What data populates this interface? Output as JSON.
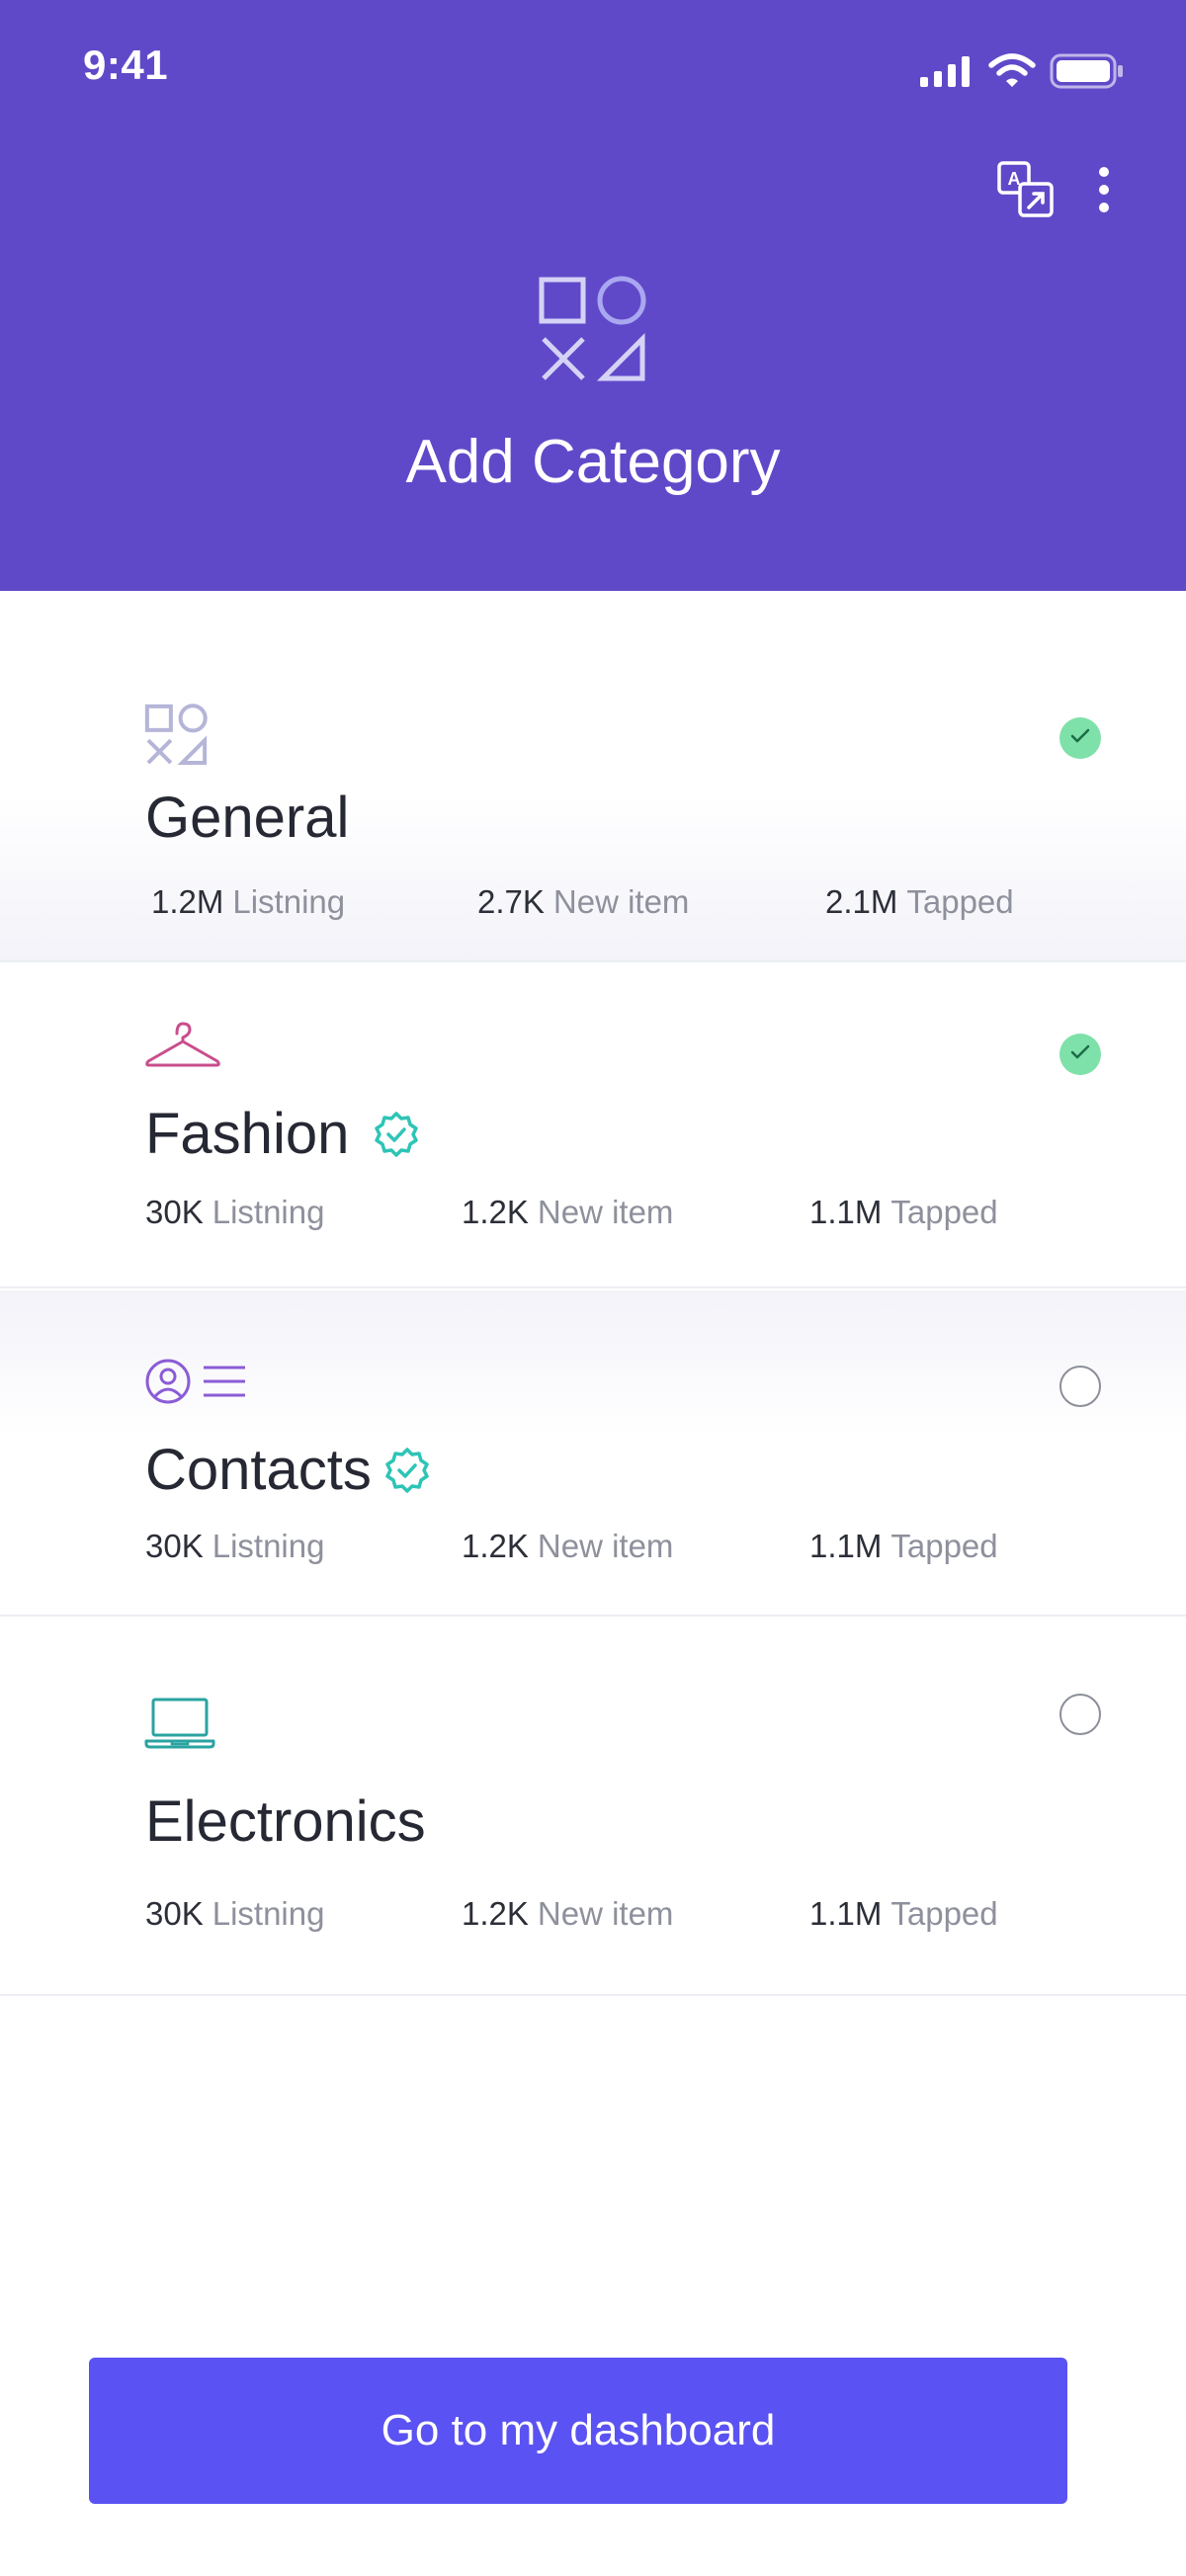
{
  "status_bar": {
    "time": "9:41"
  },
  "header": {
    "title": "Add Category",
    "hero_icon": "shapes-icon",
    "actions": [
      "translate-icon",
      "more-vertical-icon"
    ],
    "background": "#6049c9"
  },
  "categories": [
    {
      "name": "General",
      "icon": "shapes-icon",
      "verified": false,
      "selected": true,
      "stats": [
        {
          "value": "1.2M",
          "label": "Listning"
        },
        {
          "value": "2.7K",
          "label": "New item"
        },
        {
          "value": "2.1M",
          "label": "Tapped"
        }
      ]
    },
    {
      "name": "Fashion",
      "icon": "hanger-icon",
      "verified": true,
      "selected": true,
      "stats": [
        {
          "value": "30K",
          "label": "Listning"
        },
        {
          "value": "1.2K",
          "label": "New item"
        },
        {
          "value": "1.1M",
          "label": "Tapped"
        }
      ]
    },
    {
      "name": "Contacts",
      "icon": "contacts-icon",
      "verified": true,
      "selected": false,
      "stats": [
        {
          "value": "30K",
          "label": "Listning"
        },
        {
          "value": "1.2K",
          "label": "New item"
        },
        {
          "value": "1.1M",
          "label": "Tapped"
        }
      ]
    },
    {
      "name": "Electronics",
      "icon": "laptop-icon",
      "verified": false,
      "selected": false,
      "stats": [
        {
          "value": "30K",
          "label": "Listning"
        },
        {
          "value": "1.2K",
          "label": "New item"
        },
        {
          "value": "1.1M",
          "label": "Tapped"
        }
      ]
    }
  ],
  "cta": {
    "label": "Go to my dashboard",
    "color": "#5a52f2"
  },
  "colors": {
    "check_selected": "#7ee1a9",
    "verified_badge": "#2ec4b6",
    "text_primary": "#262833",
    "text_secondary": "#8e909c"
  }
}
